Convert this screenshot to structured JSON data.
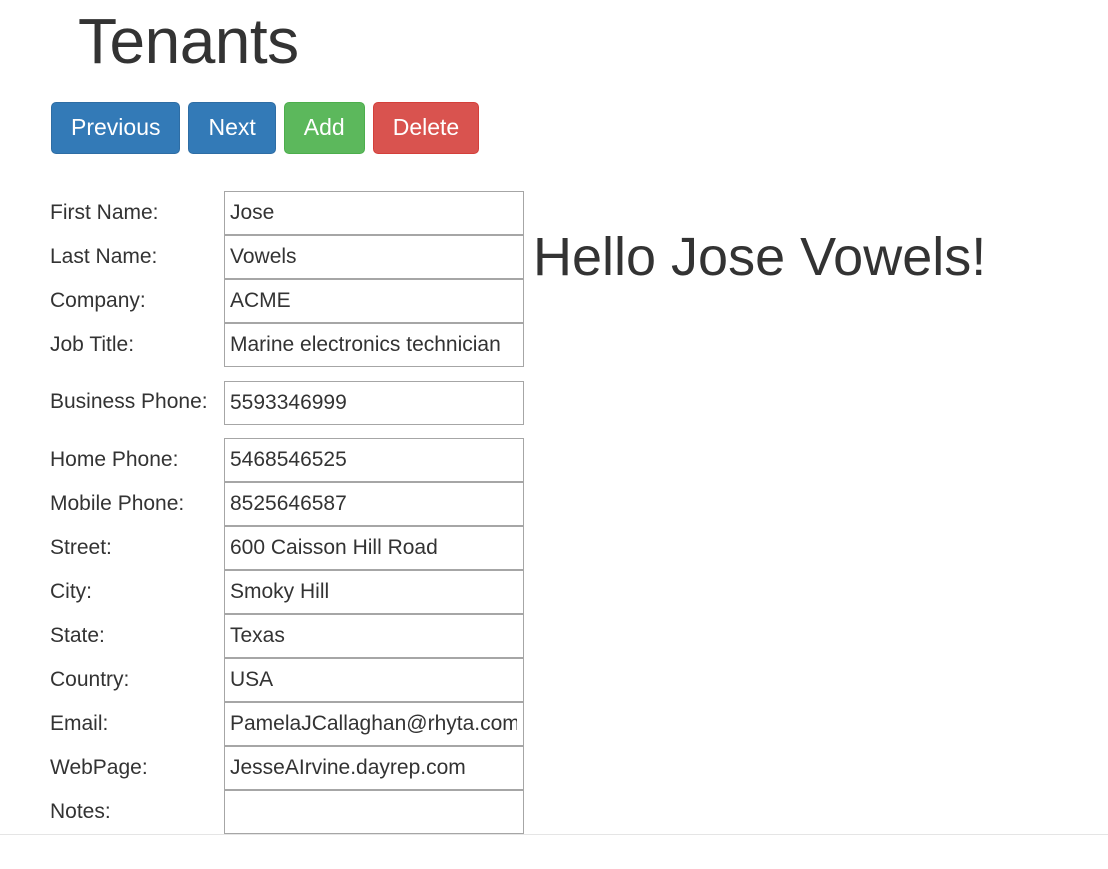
{
  "page": {
    "title": "Tenants"
  },
  "toolbar": {
    "buttons": [
      {
        "label": "Previous",
        "style": "primary",
        "name": "previous-button"
      },
      {
        "label": "Next",
        "style": "primary",
        "name": "next-button"
      },
      {
        "label": "Add",
        "style": "success",
        "name": "add-button"
      },
      {
        "label": "Delete",
        "style": "danger",
        "name": "delete-button"
      }
    ]
  },
  "form": {
    "fields": [
      {
        "label": "First Name:",
        "value": "Jose",
        "name": "first-name",
        "tall": false
      },
      {
        "label": "Last Name:",
        "value": "Vowels",
        "name": "last-name",
        "tall": false
      },
      {
        "label": "Company:",
        "value": "ACME",
        "name": "company",
        "tall": false
      },
      {
        "label": "Job Title:",
        "value": "Marine electronics technician",
        "name": "job-title",
        "tall": false
      },
      {
        "label": "Business Phone:",
        "value": "5593346999",
        "name": "business-phone",
        "tall": true
      },
      {
        "label": "Home Phone:",
        "value": "5468546525",
        "name": "home-phone",
        "tall": false
      },
      {
        "label": "Mobile Phone:",
        "value": "8525646587",
        "name": "mobile-phone",
        "tall": false
      },
      {
        "label": "Street:",
        "value": "600 Caisson Hill Road",
        "name": "street",
        "tall": false
      },
      {
        "label": "City:",
        "value": "Smoky Hill",
        "name": "city",
        "tall": false
      },
      {
        "label": "State:",
        "value": "Texas",
        "name": "state",
        "tall": false
      },
      {
        "label": "Country:",
        "value": "USA",
        "name": "country",
        "tall": false
      },
      {
        "label": "Email:",
        "value": "PamelaJCallaghan@rhyta.com",
        "name": "email",
        "tall": false
      },
      {
        "label": "WebPage:",
        "value": "JesseAIrvine.dayrep.com",
        "name": "webpage",
        "tall": false
      },
      {
        "label": "Notes:",
        "value": "",
        "name": "notes",
        "tall": false
      }
    ]
  },
  "greeting": {
    "text": "Hello Jose Vowels!"
  },
  "colors": {
    "primary": "#337ab7",
    "success": "#5cb85c",
    "danger": "#d9534f",
    "text": "#333333",
    "input_border": "#a6a6a6",
    "divider": "#e5e5e5"
  }
}
